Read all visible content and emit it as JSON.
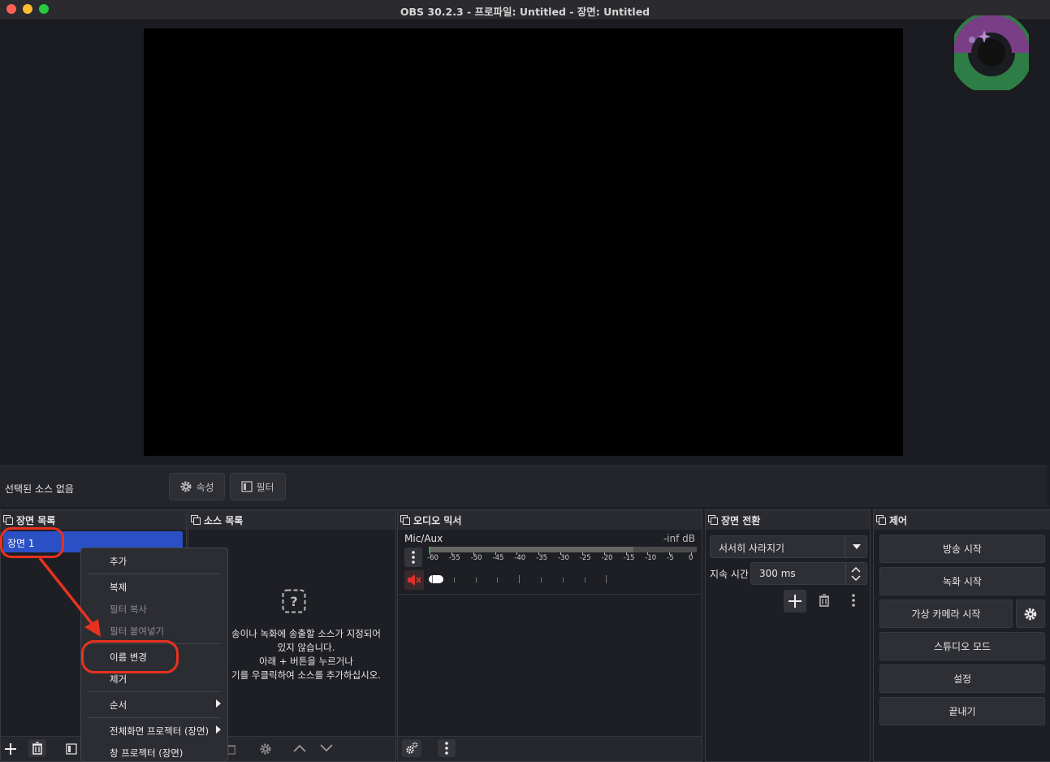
{
  "window": {
    "title": "OBS 30.2.3 - 프로파일: Untitled - 장면: Untitled",
    "traffic_lights": {
      "close": "#ff5f57",
      "minimize": "#febc2e",
      "zoom": "#28c840"
    }
  },
  "source_bar": {
    "no_source_label": "선택된 소스 없음",
    "properties_label": "속성",
    "filters_label": "필터"
  },
  "scenes": {
    "title": "장면 목록",
    "items": [
      {
        "label": "장면 1"
      }
    ]
  },
  "sources": {
    "title": "소스 목록",
    "empty_lines": [
      "송이나 녹화에 송출할 소스가 지정되어",
      "있지 않습니다.",
      "아래 + 버튼을 누르거나",
      "기를 우클릭하여 소스를 추가하십시오."
    ]
  },
  "context_menu": {
    "items": [
      {
        "label": "추가",
        "enabled": true
      },
      {
        "label": "복제",
        "enabled": true
      },
      {
        "label": "필터 복사",
        "enabled": false
      },
      {
        "label": "필터 붙여넣기",
        "enabled": false
      },
      {
        "label": "이름 변경",
        "enabled": true,
        "highlighted": true
      },
      {
        "label": "제거",
        "enabled": true
      },
      {
        "label": "순서",
        "enabled": true,
        "submenu": true
      },
      {
        "label": "전체화면 프로젝터 (장면)",
        "enabled": true,
        "submenu": true
      },
      {
        "label": "창 프로젝터 (장면)",
        "enabled": true
      }
    ]
  },
  "audio_mixer": {
    "title": "오디오 믹서",
    "channel_name": "Mic/Aux",
    "level_text": "-inf dB",
    "meter_ticks": [
      "-60",
      "-55",
      "-50",
      "-45",
      "-40",
      "-35",
      "-30",
      "-25",
      "-20",
      "-15",
      "-10",
      "-5",
      "0"
    ],
    "muted": true,
    "volume_fraction": 0.0
  },
  "transitions": {
    "title": "장면 전환",
    "selected": "서서히 사라지기",
    "duration_label": "지속 시간",
    "duration_value": "300 ms"
  },
  "controls": {
    "title": "제어",
    "start_streaming": "방송 시작",
    "start_recording": "녹화 시작",
    "start_virtualcam": "가상 카메라 시작",
    "studio_mode": "스튜디오 모드",
    "settings": "설정",
    "exit": "끝내기"
  },
  "colors": {
    "accent_selection": "#2b50c6",
    "annotation_red": "#e8321f",
    "mute_red": "#d9302c"
  }
}
